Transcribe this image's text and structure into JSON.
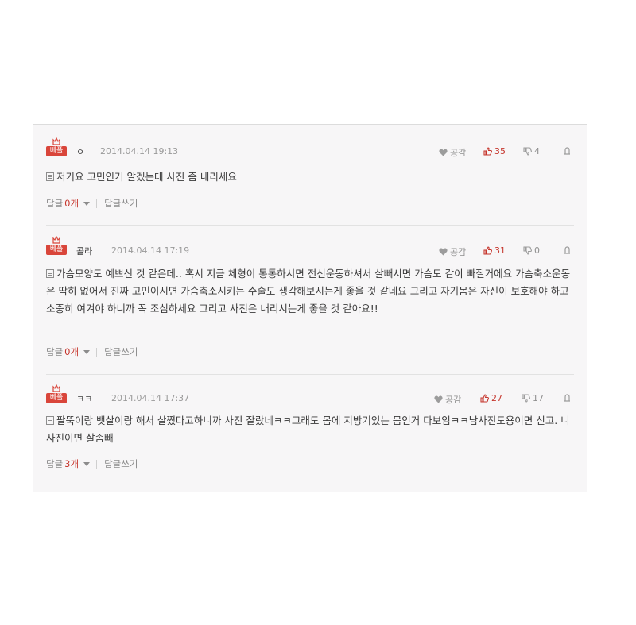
{
  "comments": [
    {
      "badge": "베플",
      "author": "ㅇ",
      "date": "2014.04.14 19:13",
      "like_label": "공감",
      "up_count": "35",
      "down_count": "4",
      "text": "저기요 고민인거 알겠는데 사진 좀 내리세요",
      "reply_label": "답글",
      "reply_count": "0개",
      "write_reply": "답글쓰기"
    },
    {
      "badge": "베플",
      "author": "콜라",
      "date": "2014.04.14 17:19",
      "like_label": "공감",
      "up_count": "31",
      "down_count": "0",
      "text": "가슴모양도 예쁘신 것 같은데.. 혹시 지금 체형이 통통하시면 전신운동하셔서 살빼시면 가슴도 같이 빠질거에요 가슴축소운동은 딱히 없어서 진짜 고민이시면 가슴축소시키는 수술도 생각해보시는게 좋을 것 같네요 그리고 자기몸은 자신이 보호해야 하고 소중히 여겨야 하니까 꼭 조심하세요 그리고 사진은 내리시는게 좋을 것 같아요!!",
      "reply_label": "답글",
      "reply_count": "0개",
      "write_reply": "답글쓰기"
    },
    {
      "badge": "베플",
      "author": "ㅋㅋ",
      "date": "2014.04.14 17:37",
      "like_label": "공감",
      "up_count": "27",
      "down_count": "17",
      "text": "팔뚝이랑 뱃살이랑 해서 살쪘다고하니까 사진 잘랐네ㅋㅋ그래도 몸에 지방기있는 몸인거 다보임ㅋㅋ남사진도용이면 신고. 니사진이면 살좀빼",
      "reply_label": "답글",
      "reply_count": "3개",
      "write_reply": "답글쓰기"
    }
  ],
  "colors": {
    "accent": "#c6362d",
    "badge": "#d9453a"
  },
  "icons": [
    "crown-icon",
    "heart-icon",
    "thumbs-up-icon",
    "thumbs-down-icon",
    "report-icon",
    "document-icon",
    "caret-down-icon"
  ]
}
